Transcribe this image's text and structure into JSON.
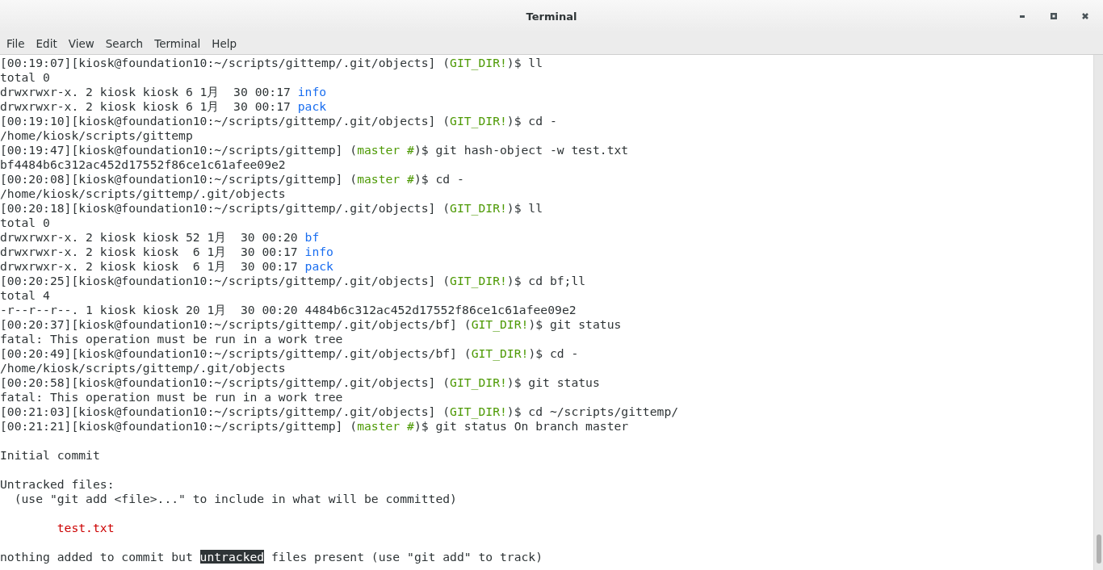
{
  "window": {
    "title": "Terminal"
  },
  "menu": [
    {
      "label": "File"
    },
    {
      "label": "Edit"
    },
    {
      "label": "View"
    },
    {
      "label": "Search"
    },
    {
      "label": "Terminal"
    },
    {
      "label": "Help"
    }
  ],
  "output": [
    [
      [
        {
          "text": "[00:19:07][kiosk@foundation10:~/scripts/gittemp/.git/objects] (",
          "kind": "plain"
        },
        {
          "text": "GIT_DIR!",
          "kind": "tag"
        },
        {
          "text": ")$ ll",
          "kind": "plain"
        }
      ],
      [
        {
          "text": "total 0",
          "kind": "plain"
        }
      ],
      [
        {
          "text": "drwxrwxr-x. 2 kiosk kiosk 6 1月  30 00:17 ",
          "kind": "plain"
        },
        {
          "text": "info",
          "kind": "dir"
        }
      ],
      [
        {
          "text": "drwxrwxr-x. 2 kiosk kiosk 6 1月  30 00:17 ",
          "kind": "plain"
        },
        {
          "text": "pack",
          "kind": "dir"
        }
      ],
      [
        {
          "text": "[00:19:10][kiosk@foundation10:~/scripts/gittemp/.git/objects] (",
          "kind": "plain"
        },
        {
          "text": "GIT_DIR!",
          "kind": "tag"
        },
        {
          "text": ")$ cd -",
          "kind": "plain"
        }
      ],
      [
        {
          "text": "/home/kiosk/scripts/gittemp",
          "kind": "plain"
        }
      ],
      [
        {
          "text": "[00:19:47][kiosk@foundation10:~/scripts/gittemp] (",
          "kind": "plain"
        },
        {
          "text": "master #",
          "kind": "tag"
        },
        {
          "text": ")$ git hash-object -w test.txt",
          "kind": "plain"
        }
      ],
      [
        {
          "text": "bf4484b6c312ac452d17552f86ce1c61afee09e2",
          "kind": "plain"
        }
      ],
      [
        {
          "text": "[00:20:08][kiosk@foundation10:~/scripts/gittemp] (",
          "kind": "plain"
        },
        {
          "text": "master #",
          "kind": "tag"
        },
        {
          "text": ")$ cd -",
          "kind": "plain"
        }
      ],
      [
        {
          "text": "/home/kiosk/scripts/gittemp/.git/objects",
          "kind": "plain"
        }
      ],
      [
        {
          "text": "[00:20:18][kiosk@foundation10:~/scripts/gittemp/.git/objects] (",
          "kind": "plain"
        },
        {
          "text": "GIT_DIR!",
          "kind": "tag"
        },
        {
          "text": ")$ ll",
          "kind": "plain"
        }
      ],
      [
        {
          "text": "total 0",
          "kind": "plain"
        }
      ],
      [
        {
          "text": "drwxrwxr-x. 2 kiosk kiosk 52 1月  30 00:20 ",
          "kind": "plain"
        },
        {
          "text": "bf",
          "kind": "dir"
        }
      ],
      [
        {
          "text": "drwxrwxr-x. 2 kiosk kiosk  6 1月  30 00:17 ",
          "kind": "plain"
        },
        {
          "text": "info",
          "kind": "dir"
        }
      ],
      [
        {
          "text": "drwxrwxr-x. 2 kiosk kiosk  6 1月  30 00:17 ",
          "kind": "plain"
        },
        {
          "text": "pack",
          "kind": "dir"
        }
      ],
      [
        {
          "text": "[00:20:25][kiosk@foundation10:~/scripts/gittemp/.git/objects] (",
          "kind": "plain"
        },
        {
          "text": "GIT_DIR!",
          "kind": "tag"
        },
        {
          "text": ")$ cd bf;ll",
          "kind": "plain"
        }
      ],
      [
        {
          "text": "total 4",
          "kind": "plain"
        }
      ],
      [
        {
          "text": "-r--r--r--. 1 kiosk kiosk 20 1月  30 00:20 4484b6c312ac452d17552f86ce1c61afee09e2",
          "kind": "plain"
        }
      ],
      [
        {
          "text": "[00:20:37][kiosk@foundation10:~/scripts/gittemp/.git/objects/bf] (",
          "kind": "plain"
        },
        {
          "text": "GIT_DIR!",
          "kind": "tag"
        },
        {
          "text": ")$ git status",
          "kind": "plain"
        }
      ],
      [
        {
          "text": "fatal: This operation must be run in a work tree",
          "kind": "plain"
        }
      ],
      [
        {
          "text": "[00:20:49][kiosk@foundation10:~/scripts/gittemp/.git/objects/bf] (",
          "kind": "plain"
        },
        {
          "text": "GIT_DIR!",
          "kind": "tag"
        },
        {
          "text": ")$ cd -",
          "kind": "plain"
        }
      ],
      [
        {
          "text": "/home/kiosk/scripts/gittemp/.git/objects",
          "kind": "plain"
        }
      ],
      [
        {
          "text": "[00:20:58][kiosk@foundation10:~/scripts/gittemp/.git/objects] (",
          "kind": "plain"
        },
        {
          "text": "GIT_DIR!",
          "kind": "tag"
        },
        {
          "text": ")$ git status",
          "kind": "plain"
        }
      ],
      [
        {
          "text": "fatal: This operation must be run in a work tree",
          "kind": "plain"
        }
      ],
      [
        {
          "text": "[00:21:03][kiosk@foundation10:~/scripts/gittemp/.git/objects] (",
          "kind": "plain"
        },
        {
          "text": "GIT_DIR!",
          "kind": "tag"
        },
        {
          "text": ")$ cd ~/scripts/gittemp/",
          "kind": "plain"
        }
      ],
      [
        {
          "text": "[00:21:21][kiosk@foundation10:~/scripts/gittemp] (",
          "kind": "plain"
        },
        {
          "text": "master #",
          "kind": "tag"
        },
        {
          "text": ")$ git status On branch master",
          "kind": "plain"
        }
      ]
    ],
    [
      [
        {
          "text": "Initial commit",
          "kind": "plain"
        }
      ]
    ],
    [
      [
        {
          "text": "Untracked files:",
          "kind": "plain"
        }
      ],
      [
        {
          "text": "  (use \"git add <file>...\" to include in what will be committed)",
          "kind": "plain"
        }
      ]
    ],
    [
      [
        {
          "text": "test.txt",
          "kind": "untracked"
        }
      ]
    ],
    [
      [
        {
          "text": "nothing added to commit but ",
          "kind": "plain"
        },
        {
          "text": "untracked",
          "kind": "selected"
        },
        {
          "text": " files present (use \"git add\" to track)",
          "kind": "plain"
        }
      ]
    ]
  ]
}
